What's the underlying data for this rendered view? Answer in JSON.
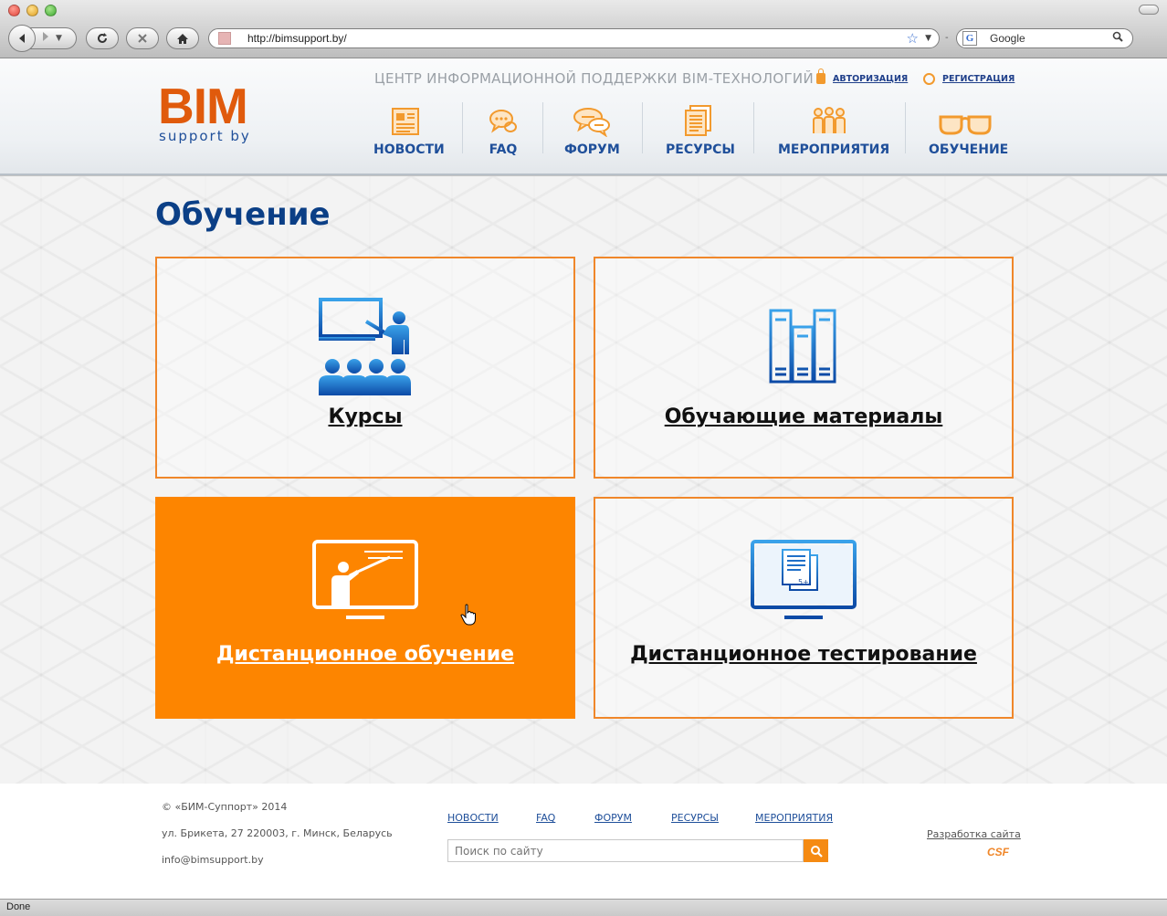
{
  "browser": {
    "url": "http://bimsupport.by/",
    "search_engine": "Google",
    "status": "Done"
  },
  "header": {
    "logo_main": "BIM",
    "logo_sub": "support by",
    "tagline": "ЦЕНТР ИНФОРМАЦИОННОЙ ПОДДЕРЖКИ BIM-ТЕХНОЛОГИЙ",
    "auth_label": "АВТОРИЗАЦИЯ",
    "register_label": "РЕГИСТРАЦИЯ",
    "nav": [
      {
        "label": "НОВОСТИ",
        "icon": "newspaper-icon"
      },
      {
        "label": "FAQ",
        "icon": "question-bubble-icon"
      },
      {
        "label": "ФОРУМ",
        "icon": "chat-bubbles-icon"
      },
      {
        "label": "РЕСУРСЫ",
        "icon": "documents-icon"
      },
      {
        "label": "МЕРОПРИЯТИЯ",
        "icon": "people-icon"
      },
      {
        "label": "ОБУЧЕНИЕ",
        "icon": "glasses-icon"
      }
    ]
  },
  "page": {
    "title": "Обучение",
    "tiles": [
      {
        "label": "Курсы",
        "icon": "classroom-icon",
        "active": false
      },
      {
        "label": "Обучающие материалы",
        "icon": "binders-icon",
        "active": false
      },
      {
        "label": "Дистанционное обучение",
        "icon": "distance-teaching-icon",
        "active": true
      },
      {
        "label": "Дистанционное тестирование",
        "icon": "distance-testing-icon",
        "active": false
      }
    ]
  },
  "footer": {
    "copyright": "© «БИМ-Суппорт» 2014",
    "address": "ул. Брикета, 27 220003, г. Минск, Беларусь",
    "email": "info@bimsupport.by",
    "links": [
      "НОВОСТИ",
      "FAQ",
      "ФОРУМ",
      "РЕСУРСЫ",
      "МЕРОПРИЯТИЯ"
    ],
    "search_placeholder": "Поиск по сайту",
    "developer_label": "Разработка сайта",
    "developer_logo": "CSF"
  },
  "colors": {
    "accent": "#fd8500",
    "brand_blue": "#1f4f9a",
    "title_blue": "#0b3f86",
    "logo_orange": "#e05a0c"
  }
}
